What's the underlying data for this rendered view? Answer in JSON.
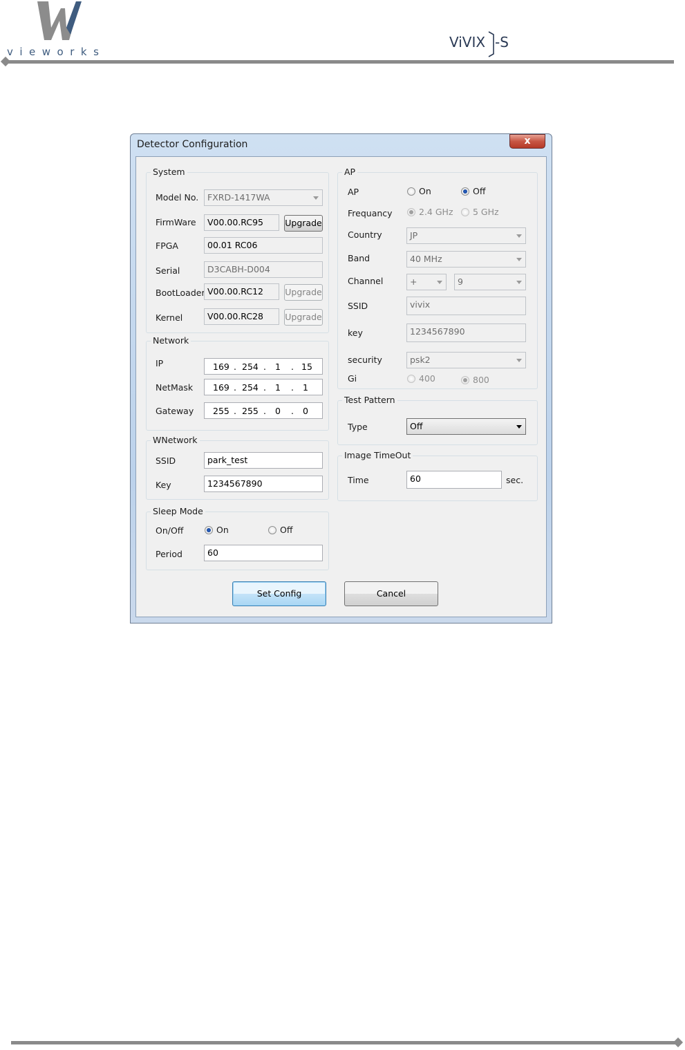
{
  "header": {
    "brand_text": "vieworks",
    "product_logo": "ViVIX-S"
  },
  "dialog": {
    "title": "Detector Configuration",
    "close_label": "x",
    "system": {
      "title": "System",
      "model_label": "Model No.",
      "model_value": "FXRD-1417WA",
      "firmware_label": "FirmWare",
      "firmware_value": "V00.00.RC95",
      "firmware_button": "Upgrade",
      "fpga_label": "FPGA",
      "fpga_value": "00.01 RC06",
      "serial_label": "Serial",
      "serial_value": "D3CABH-D004",
      "bootloader_label": "BootLoader",
      "bootloader_value": "V00.00.RC12",
      "bootloader_button": "Upgrade",
      "kernel_label": "Kernel",
      "kernel_value": "V00.00.RC28",
      "kernel_button": "Upgrade"
    },
    "network": {
      "title": "Network",
      "ip_label": "IP",
      "ip": [
        "169",
        "254",
        "1",
        "15"
      ],
      "netmask_label": "NetMask",
      "netmask": [
        "169",
        "254",
        "1",
        "1"
      ],
      "gateway_label": "Gateway",
      "gateway": [
        "255",
        "255",
        "0",
        "0"
      ],
      "dot": "."
    },
    "wnetwork": {
      "title": "WNetwork",
      "ssid_label": "SSID",
      "ssid_value": "park_test",
      "key_label": "Key",
      "key_value": "1234567890"
    },
    "sleep": {
      "title": "Sleep Mode",
      "onoff_label": "On/Off",
      "on_label": "On",
      "off_label": "Off",
      "selected": "On",
      "period_label": "Period",
      "period_value": "60"
    },
    "ap": {
      "title": "AP",
      "ap_label": "AP",
      "ap_on": "On",
      "ap_off": "Off",
      "ap_selected": "Off",
      "frequency_label": "Frequancy",
      "freq_24": "2.4 GHz",
      "freq_5": "5 GHz",
      "freq_selected": "2.4 GHz",
      "country_label": "Country",
      "country_value": "JP",
      "band_label": "Band",
      "band_value": "40 MHz",
      "channel_label": "Channel",
      "channel_sign": "+",
      "channel_value": "9",
      "ssid_label": "SSID",
      "ssid_value": "vivix",
      "key_label": "key",
      "key_value": "1234567890",
      "security_label": "security",
      "security_value": "psk2",
      "gi_label": "Gi",
      "gi_400": "400",
      "gi_800": "800",
      "gi_selected": "800"
    },
    "test_pattern": {
      "title": "Test Pattern",
      "type_label": "Type",
      "type_value": "Off"
    },
    "image_timeout": {
      "title": "Image TimeOut",
      "time_label": "Time",
      "time_value": "60",
      "unit": "sec."
    },
    "buttons": {
      "set_config": "Set Config",
      "cancel": "Cancel"
    }
  },
  "colors": {
    "header_rule": "#8a8a8a",
    "logo_blue": "#3f5c7f",
    "logo_gray": "#8c8c8c",
    "accent_blue": "#2e7fd6"
  }
}
